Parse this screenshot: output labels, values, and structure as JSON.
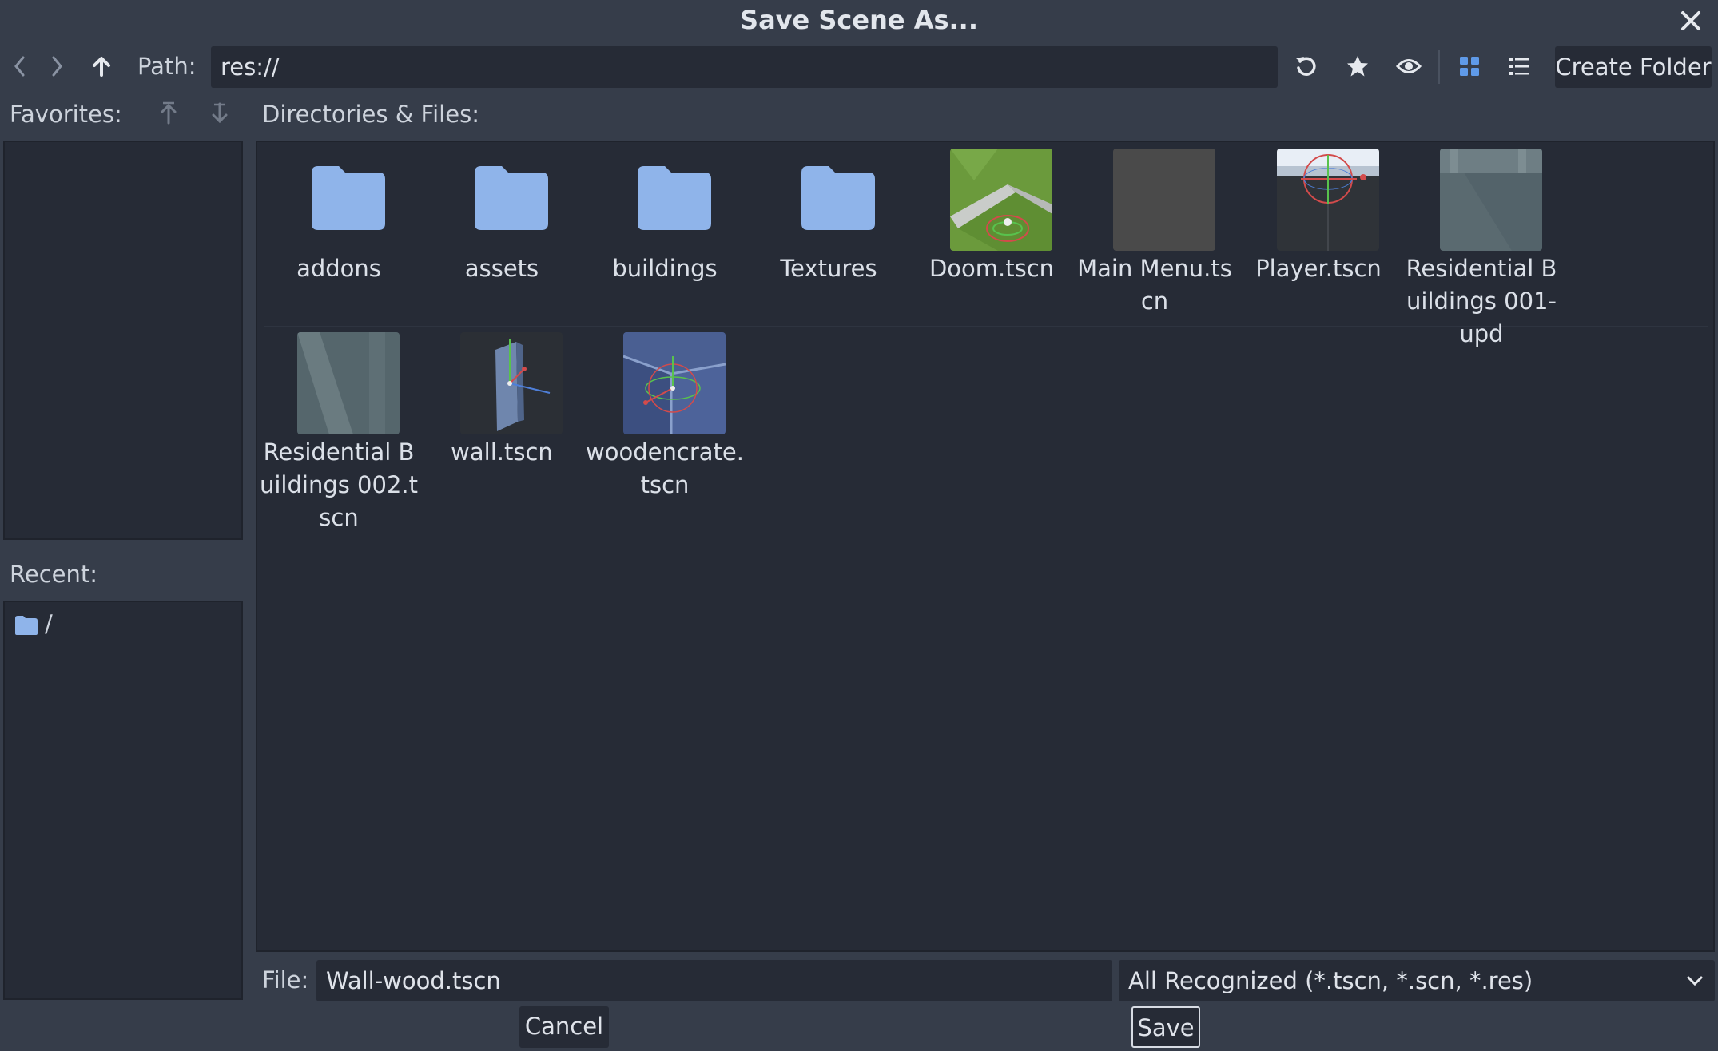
{
  "dialog": {
    "title": "Save Scene As..."
  },
  "toolbar": {
    "path_label": "Path:",
    "path_value": "res://",
    "create_folder_label": "Create Folder"
  },
  "sidebar": {
    "favorites_label": "Favorites:",
    "recent_label": "Recent:",
    "recent_items": [
      {
        "label": "/",
        "icon": "folder-icon"
      }
    ]
  },
  "files": {
    "header_label": "Directories & Files:",
    "items": [
      {
        "name": "addons",
        "type": "folder"
      },
      {
        "name": "assets",
        "type": "folder"
      },
      {
        "name": "buildings",
        "type": "folder"
      },
      {
        "name": "Textures",
        "type": "folder"
      },
      {
        "name": "Doom.tscn",
        "type": "scene"
      },
      {
        "name": "Main Menu.tscn",
        "type": "scene"
      },
      {
        "name": "Player.tscn",
        "type": "scene"
      },
      {
        "name": "Residential Buildings 001-upd",
        "type": "scene"
      },
      {
        "name": "Residential Buildings 002.tscn",
        "type": "scene"
      },
      {
        "name": "wall.tscn",
        "type": "scene"
      },
      {
        "name": "woodencrate.tscn",
        "type": "scene"
      }
    ]
  },
  "footer": {
    "file_label": "File:",
    "file_value": "Wall-wood.tscn",
    "filter_value": "All Recognized (*.tscn, *.scn, *.res)",
    "cancel_label": "Cancel",
    "save_label": "Save"
  },
  "colors": {
    "background": "#363d4a",
    "panel": "#262b36",
    "folder": "#8fb4ea",
    "accent": "#5f9ae8"
  }
}
